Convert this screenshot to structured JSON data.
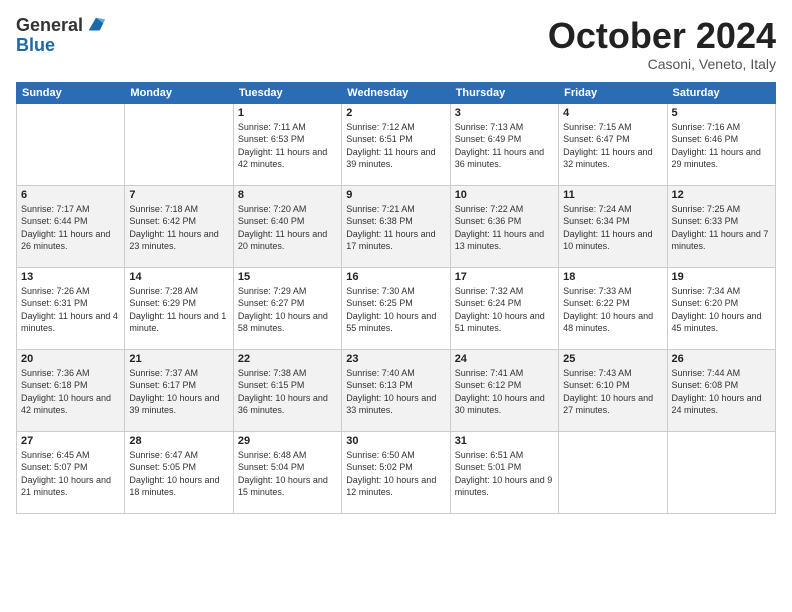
{
  "logo": {
    "general": "General",
    "blue": "Blue"
  },
  "header": {
    "month": "October 2024",
    "location": "Casoni, Veneto, Italy"
  },
  "weekdays": [
    "Sunday",
    "Monday",
    "Tuesday",
    "Wednesday",
    "Thursday",
    "Friday",
    "Saturday"
  ],
  "weeks": [
    [
      {
        "day": "",
        "info": ""
      },
      {
        "day": "",
        "info": ""
      },
      {
        "day": "1",
        "info": "Sunrise: 7:11 AM\nSunset: 6:53 PM\nDaylight: 11 hours and 42 minutes."
      },
      {
        "day": "2",
        "info": "Sunrise: 7:12 AM\nSunset: 6:51 PM\nDaylight: 11 hours and 39 minutes."
      },
      {
        "day": "3",
        "info": "Sunrise: 7:13 AM\nSunset: 6:49 PM\nDaylight: 11 hours and 36 minutes."
      },
      {
        "day": "4",
        "info": "Sunrise: 7:15 AM\nSunset: 6:47 PM\nDaylight: 11 hours and 32 minutes."
      },
      {
        "day": "5",
        "info": "Sunrise: 7:16 AM\nSunset: 6:46 PM\nDaylight: 11 hours and 29 minutes."
      }
    ],
    [
      {
        "day": "6",
        "info": "Sunrise: 7:17 AM\nSunset: 6:44 PM\nDaylight: 11 hours and 26 minutes."
      },
      {
        "day": "7",
        "info": "Sunrise: 7:18 AM\nSunset: 6:42 PM\nDaylight: 11 hours and 23 minutes."
      },
      {
        "day": "8",
        "info": "Sunrise: 7:20 AM\nSunset: 6:40 PM\nDaylight: 11 hours and 20 minutes."
      },
      {
        "day": "9",
        "info": "Sunrise: 7:21 AM\nSunset: 6:38 PM\nDaylight: 11 hours and 17 minutes."
      },
      {
        "day": "10",
        "info": "Sunrise: 7:22 AM\nSunset: 6:36 PM\nDaylight: 11 hours and 13 minutes."
      },
      {
        "day": "11",
        "info": "Sunrise: 7:24 AM\nSunset: 6:34 PM\nDaylight: 11 hours and 10 minutes."
      },
      {
        "day": "12",
        "info": "Sunrise: 7:25 AM\nSunset: 6:33 PM\nDaylight: 11 hours and 7 minutes."
      }
    ],
    [
      {
        "day": "13",
        "info": "Sunrise: 7:26 AM\nSunset: 6:31 PM\nDaylight: 11 hours and 4 minutes."
      },
      {
        "day": "14",
        "info": "Sunrise: 7:28 AM\nSunset: 6:29 PM\nDaylight: 11 hours and 1 minute."
      },
      {
        "day": "15",
        "info": "Sunrise: 7:29 AM\nSunset: 6:27 PM\nDaylight: 10 hours and 58 minutes."
      },
      {
        "day": "16",
        "info": "Sunrise: 7:30 AM\nSunset: 6:25 PM\nDaylight: 10 hours and 55 minutes."
      },
      {
        "day": "17",
        "info": "Sunrise: 7:32 AM\nSunset: 6:24 PM\nDaylight: 10 hours and 51 minutes."
      },
      {
        "day": "18",
        "info": "Sunrise: 7:33 AM\nSunset: 6:22 PM\nDaylight: 10 hours and 48 minutes."
      },
      {
        "day": "19",
        "info": "Sunrise: 7:34 AM\nSunset: 6:20 PM\nDaylight: 10 hours and 45 minutes."
      }
    ],
    [
      {
        "day": "20",
        "info": "Sunrise: 7:36 AM\nSunset: 6:18 PM\nDaylight: 10 hours and 42 minutes."
      },
      {
        "day": "21",
        "info": "Sunrise: 7:37 AM\nSunset: 6:17 PM\nDaylight: 10 hours and 39 minutes."
      },
      {
        "day": "22",
        "info": "Sunrise: 7:38 AM\nSunset: 6:15 PM\nDaylight: 10 hours and 36 minutes."
      },
      {
        "day": "23",
        "info": "Sunrise: 7:40 AM\nSunset: 6:13 PM\nDaylight: 10 hours and 33 minutes."
      },
      {
        "day": "24",
        "info": "Sunrise: 7:41 AM\nSunset: 6:12 PM\nDaylight: 10 hours and 30 minutes."
      },
      {
        "day": "25",
        "info": "Sunrise: 7:43 AM\nSunset: 6:10 PM\nDaylight: 10 hours and 27 minutes."
      },
      {
        "day": "26",
        "info": "Sunrise: 7:44 AM\nSunset: 6:08 PM\nDaylight: 10 hours and 24 minutes."
      }
    ],
    [
      {
        "day": "27",
        "info": "Sunrise: 6:45 AM\nSunset: 5:07 PM\nDaylight: 10 hours and 21 minutes."
      },
      {
        "day": "28",
        "info": "Sunrise: 6:47 AM\nSunset: 5:05 PM\nDaylight: 10 hours and 18 minutes."
      },
      {
        "day": "29",
        "info": "Sunrise: 6:48 AM\nSunset: 5:04 PM\nDaylight: 10 hours and 15 minutes."
      },
      {
        "day": "30",
        "info": "Sunrise: 6:50 AM\nSunset: 5:02 PM\nDaylight: 10 hours and 12 minutes."
      },
      {
        "day": "31",
        "info": "Sunrise: 6:51 AM\nSunset: 5:01 PM\nDaylight: 10 hours and 9 minutes."
      },
      {
        "day": "",
        "info": ""
      },
      {
        "day": "",
        "info": ""
      }
    ]
  ]
}
